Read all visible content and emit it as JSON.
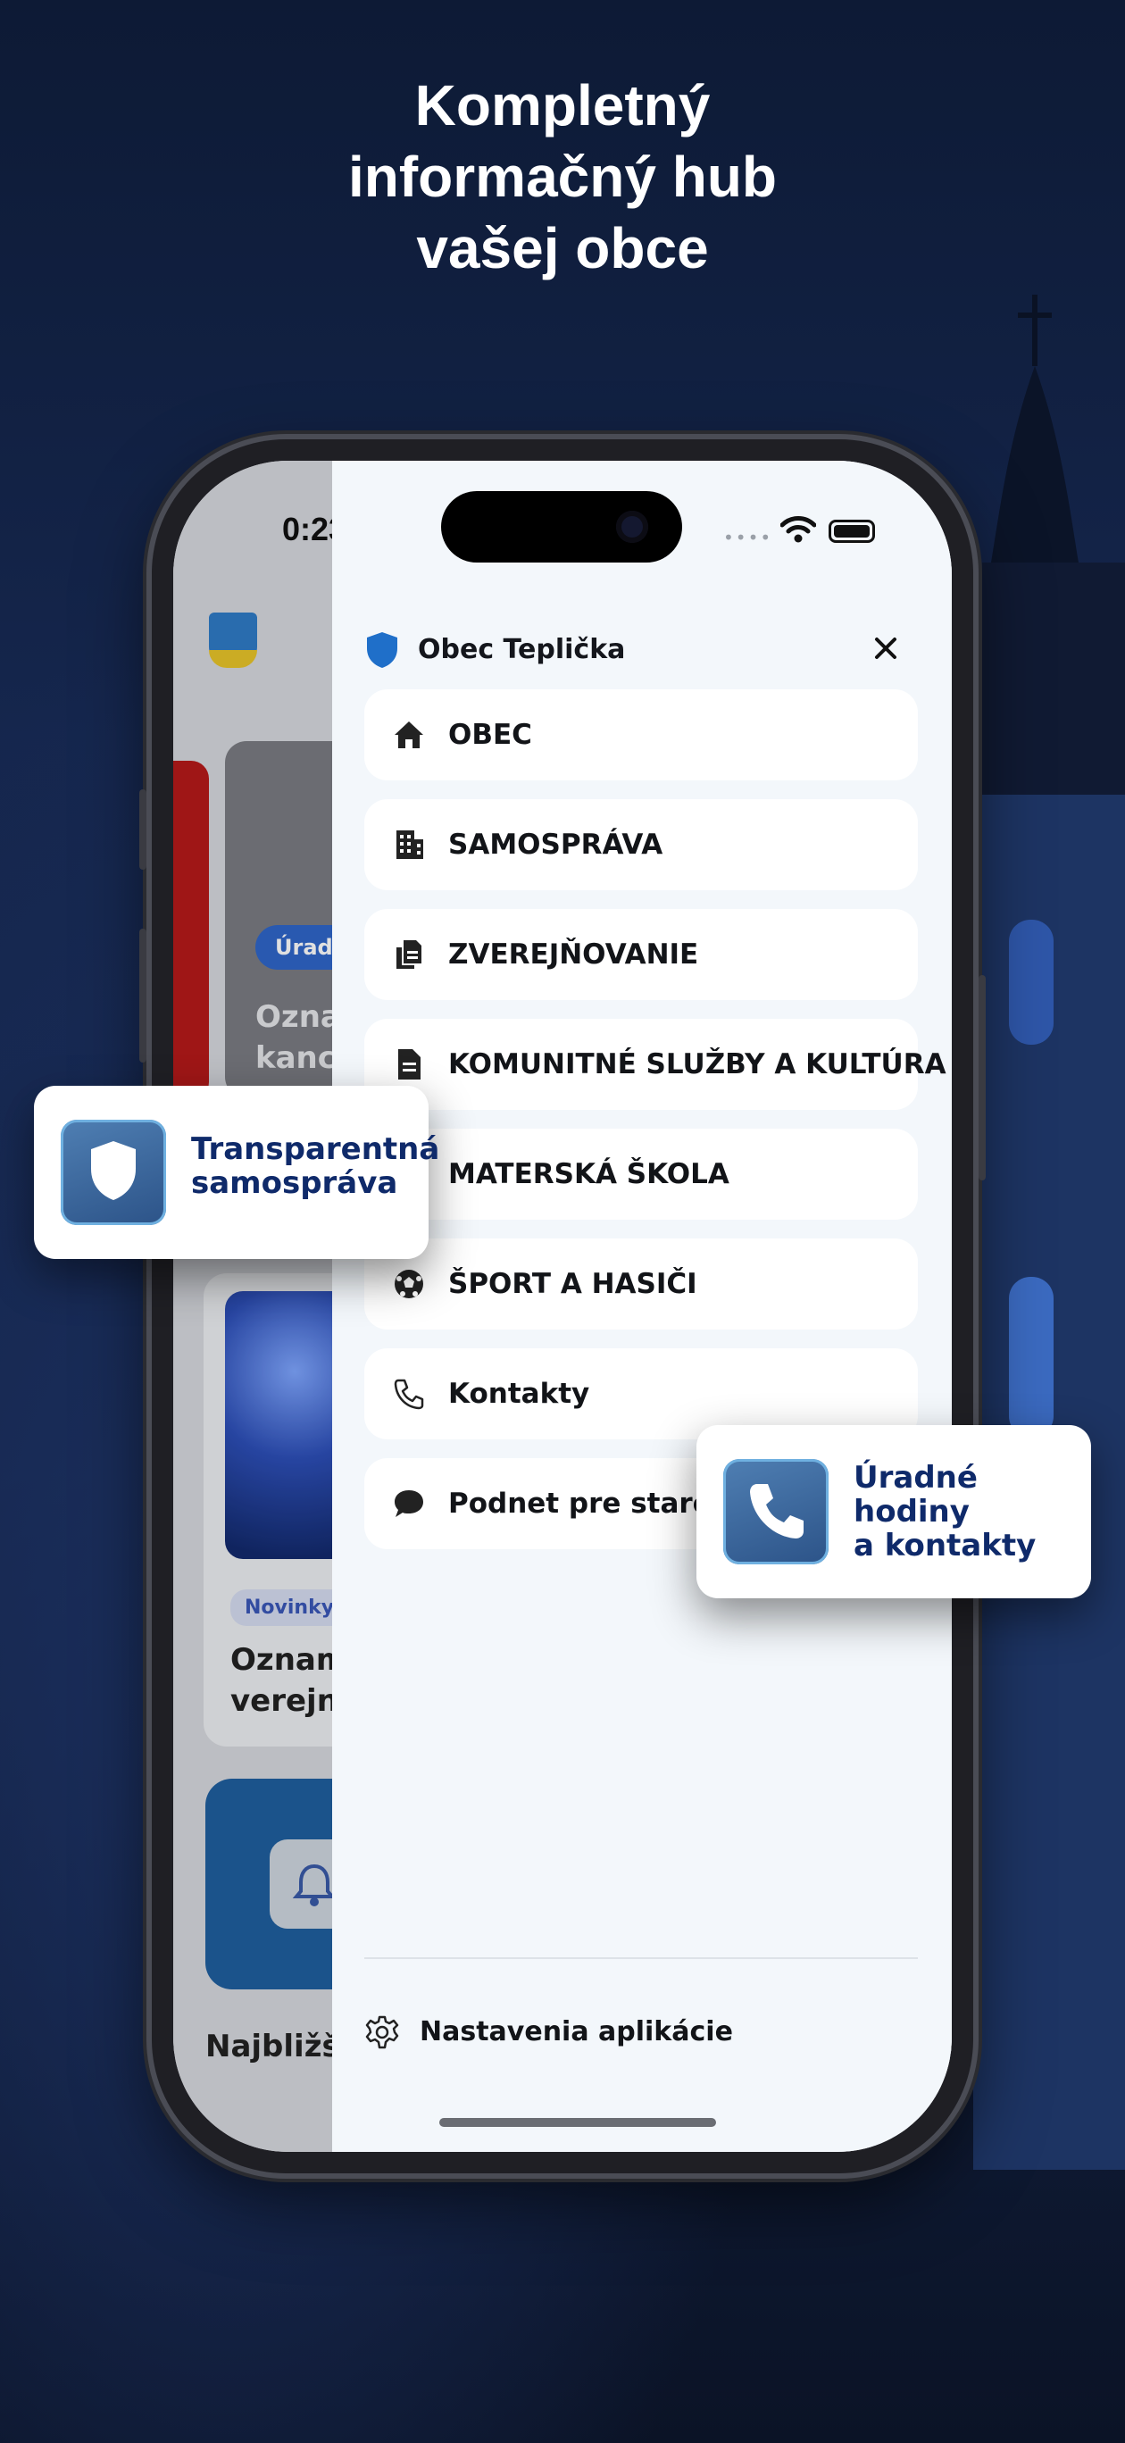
{
  "hero": {
    "line1": "Kompletný",
    "line2": "informačný hub",
    "line3": "vašej obce"
  },
  "underlying_app": {
    "status_time": "0:23",
    "card_pill": "Úrad",
    "card_title_1": "Ozna",
    "card_title_2": "kanc",
    "news_tag": "Novinky",
    "news_title_1": "Oznam",
    "news_title_2": "verejno",
    "section_heading": "Najbližši"
  },
  "drawer": {
    "title": "Obec Teplička",
    "menu": [
      {
        "label": "OBEC",
        "icon": "home-icon"
      },
      {
        "label": "SAMOSPRÁVA",
        "icon": "building-icon"
      },
      {
        "label": "ZVEREJŇOVANIE",
        "icon": "documents-icon"
      },
      {
        "label": "KOMUNITNÉ SLUŽBY A KULTÚRA",
        "icon": "document-icon"
      },
      {
        "label": "MATERSKÁ ŠKOLA",
        "icon": "school-icon"
      },
      {
        "label": "ŠPORT A HASIČI",
        "icon": "soccer-ball-icon"
      },
      {
        "label": "Kontakty",
        "icon": "phone-icon"
      },
      {
        "label": "Podnet pre starostu",
        "icon": "chat-bubble-icon"
      }
    ],
    "settings_label": "Nastavenia aplikácie"
  },
  "badges": {
    "transparency_line1": "Transparentná",
    "transparency_line2": "samospráva",
    "hours_line1": "Úradné",
    "hours_line2": "hodiny",
    "hours_line3": "a kontakty"
  },
  "colors": {
    "background": "#14254a",
    "drawer": "#f3f7fb",
    "badge_text": "#0f2a6a",
    "shield_blue": "#1f6fc9"
  }
}
